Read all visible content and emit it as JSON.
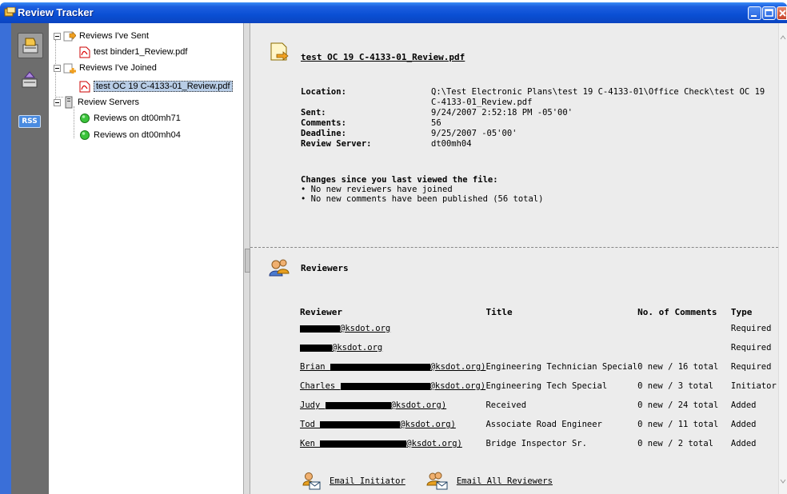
{
  "window": {
    "title": "Review Tracker"
  },
  "rail": {
    "items": [
      {
        "icon": "sent-reviews-icon"
      },
      {
        "icon": "joined-reviews-icon"
      },
      {
        "icon": "rss-icon",
        "label": "RSS"
      }
    ]
  },
  "tree": {
    "nodes": [
      {
        "label": "Reviews I've Sent",
        "icon": "folder-sent-icon"
      },
      {
        "label": "test binder1_Review.pdf",
        "icon": "pdf-icon"
      },
      {
        "label": "Reviews I've Joined",
        "icon": "folder-joined-icon"
      },
      {
        "label": "test OC 19 C-4133-01_Review.pdf",
        "icon": "pdf-icon",
        "selected": true
      },
      {
        "label": "Review Servers",
        "icon": "server-icon"
      },
      {
        "label": "Reviews on dt00mh71",
        "icon": "green-status-icon"
      },
      {
        "label": "Reviews on dt00mh04",
        "icon": "green-status-icon"
      }
    ]
  },
  "doc": {
    "title": "test OC 19 C-4133-01_Review.pdf",
    "fields": [
      {
        "key": "Location:",
        "value": "Q:\\Test Electronic Plans\\test 19 C-4133-01\\Office Check\\test OC 19 C-4133-01_Review.pdf"
      },
      {
        "key": "Sent:",
        "value": "9/24/2007 2:52:18 PM -05'00'"
      },
      {
        "key": "Comments:",
        "value": "56"
      },
      {
        "key": "Deadline:",
        "value": "9/25/2007 -05'00'"
      },
      {
        "key": "Review Server:",
        "value": "dt00mh04"
      }
    ],
    "changes_heading": "Changes since you last viewed the file:",
    "changes": [
      "• No new reviewers have joined",
      "• No new comments have been published (56 total)"
    ]
  },
  "reviewers": {
    "heading": "Reviewers",
    "columns": [
      "Reviewer",
      "Title",
      "No. of Comments",
      "Type"
    ],
    "rows": [
      {
        "name_prefix": "",
        "name_suffix": "@ksdot.org",
        "title": "",
        "comments": "",
        "type": "Required"
      },
      {
        "name_prefix": "",
        "name_suffix": "@ksdot.org",
        "title": "",
        "comments": "",
        "type": "Required"
      },
      {
        "name_prefix": "Brian ",
        "name_suffix": "@ksdot.org)",
        "title": "Engineering Technician Special",
        "comments": "0 new / 16 total",
        "type": "Required"
      },
      {
        "name_prefix": "Charles ",
        "name_suffix": "@ksdot.org)",
        "title": "Engineering Tech Special",
        "comments": "0 new / 3 total",
        "type": "Initiator"
      },
      {
        "name_prefix": "Judy ",
        "name_suffix": "@ksdot.org)",
        "title": "Received",
        "comments": "0 new / 24 total",
        "type": "Added"
      },
      {
        "name_prefix": "Tod ",
        "name_suffix": "@ksdot.org)",
        "title": "Associate Road Engineer",
        "comments": "0 new / 11 total",
        "type": "Added"
      },
      {
        "name_prefix": "Ken ",
        "name_suffix": "@ksdot.org)",
        "title": "Bridge Inspector Sr.",
        "comments": "0 new / 2 total",
        "type": "Added"
      }
    ],
    "email_initiator": "Email Initiator",
    "email_all": "Email All Reviewers"
  }
}
